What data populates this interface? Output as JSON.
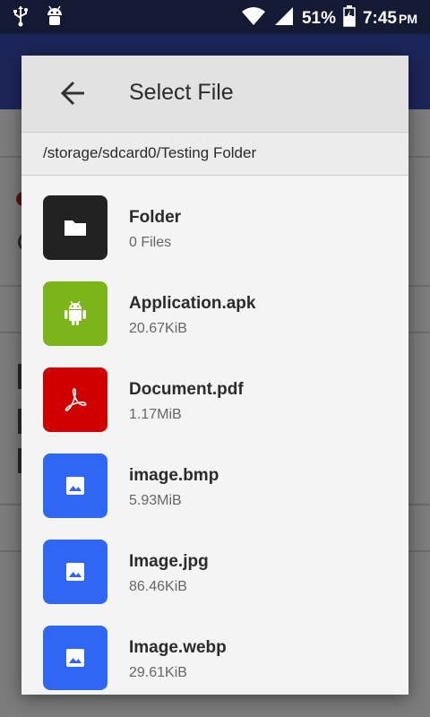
{
  "status_bar": {
    "battery_percent": "51%",
    "time": "7:45",
    "ampm": "PM"
  },
  "dialog": {
    "title": "Select File",
    "path": "/storage/sdcard0/Testing Folder",
    "files": [
      {
        "name": "Folder",
        "meta": "0 Files",
        "icon": "folder-icon",
        "color": "#222222"
      },
      {
        "name": "Application.apk",
        "meta": "20.67KiB",
        "icon": "android-icon",
        "color": "#7cb518"
      },
      {
        "name": "Document.pdf",
        "meta": "1.17MiB",
        "icon": "pdf-icon",
        "color": "#d10000"
      },
      {
        "name": "image.bmp",
        "meta": "5.93MiB",
        "icon": "image-icon",
        "color": "#2f66f3"
      },
      {
        "name": "Image.jpg",
        "meta": "86.46KiB",
        "icon": "image-icon",
        "color": "#2f66f3"
      },
      {
        "name": "Image.webp",
        "meta": "29.61KiB",
        "icon": "image-icon",
        "color": "#2f66f3"
      }
    ]
  },
  "colors": {
    "status_bar_bg": "#141a33",
    "dialog_bg": "#f4f4f4",
    "header_bg": "#e2e2e2",
    "scrim": "#7c7c7c"
  }
}
